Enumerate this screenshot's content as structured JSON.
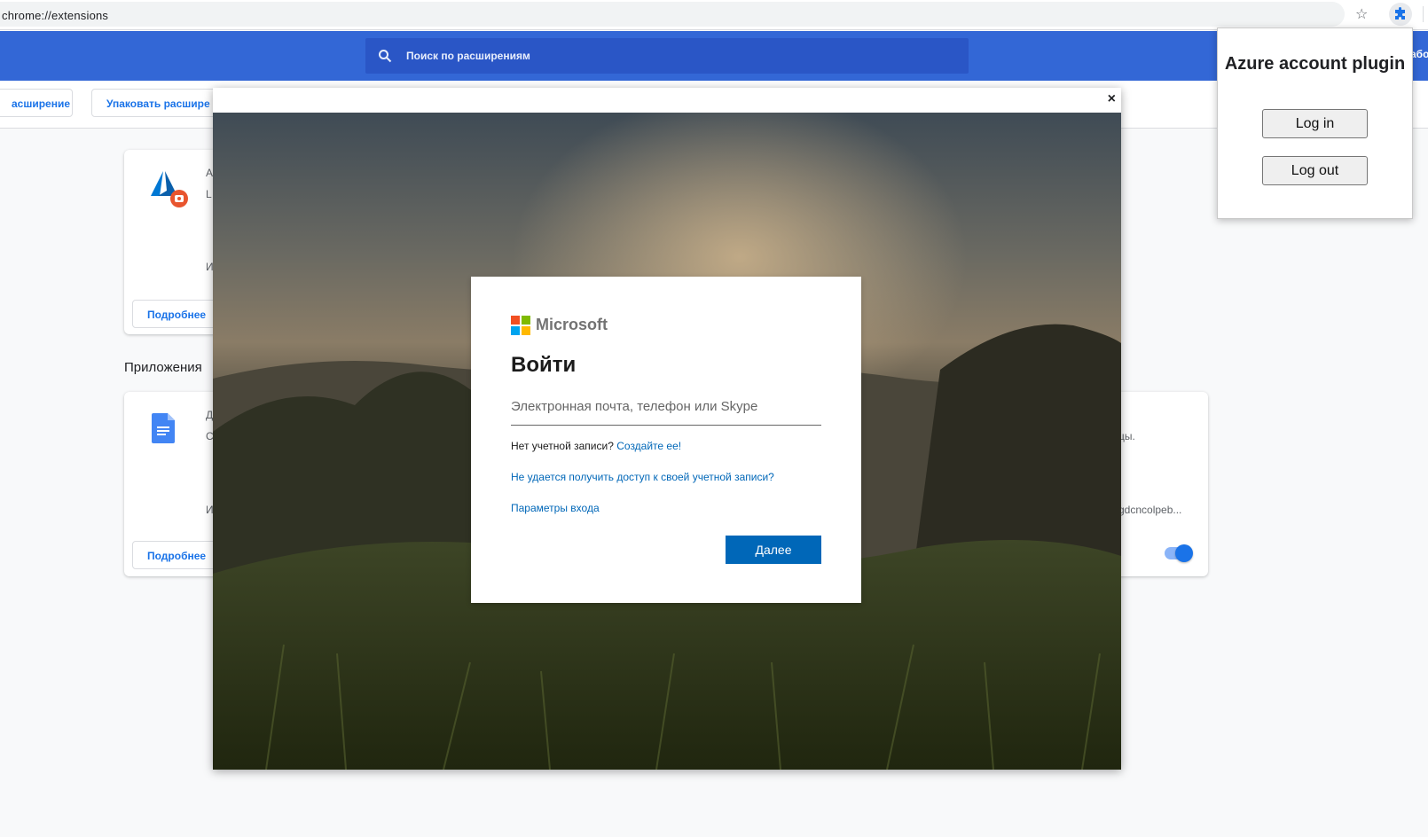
{
  "browser": {
    "url": "chrome://extensions"
  },
  "header": {
    "search_placeholder": "Поиск по расширениям",
    "dev_mode_fragment": "або"
  },
  "subbar": {
    "load_button_fragment": "асширение",
    "pack_button_fragment": "Упаковать расшире"
  },
  "extensions": {
    "card1": {
      "line1": "A",
      "line2": "L",
      "id_fragment": "И",
      "details_label": "Подробнее"
    },
    "apps_section_title": "Приложения",
    "card2": {
      "line1": "Д",
      "line2": "С",
      "id_fragment": "И",
      "details_label": "Подробнее",
      "right_desc_fragment": "цы.",
      "right_id_fragment": "gdcncolpeb..."
    }
  },
  "ms_login": {
    "brand": "Microsoft",
    "title": "Войти",
    "email_placeholder": "Электронная почта, телефон или Skype",
    "no_account_text": "Нет учетной записи?",
    "create_link": "Создайте ее!",
    "cant_access_link": "Не удается получить доступ к своей учетной записи?",
    "signin_options_link": "Параметры входа",
    "next_button": "Далее",
    "logo_colors": [
      "#f25022",
      "#7fba00",
      "#00a4ef",
      "#ffb900"
    ]
  },
  "ext_popup": {
    "title": "Azure account plugin",
    "login_button": "Log in",
    "logout_button": "Log out"
  },
  "icons": [
    "search-icon",
    "star-icon",
    "puzzle-icon",
    "close-icon",
    "azure-icon",
    "docs-icon"
  ]
}
